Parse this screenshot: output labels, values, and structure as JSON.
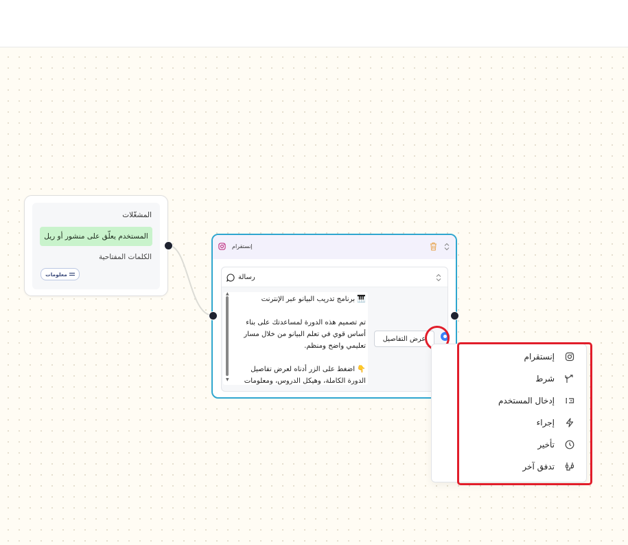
{
  "trigger_node": {
    "title": "المشغّلات",
    "trigger_text": "المستخدم يعلّق على منشور أو ريل",
    "keywords_title": "الكلمات المفتاحية",
    "info_chip_label": "معلومات"
  },
  "instagram_node": {
    "title": "إنستقرام",
    "message": {
      "title": "رسالة",
      "text": "🎹 برنامج تدريب البيانو عبر الإنترنت\n\nتم تصميم هذه الدورة لمساعدتك على بناء أساس قوي في تعلم البيانو من خلال مسار تعليمي واضح ومنظم.\n\n👇 اضغط على الزر أدناه لعرض تفاصيل الدورة الكاملة، وهيكل الدروس، ومعلومات",
      "button_label": "عرض التفاصيل"
    }
  },
  "menu": {
    "items": [
      {
        "label": "إنستقرام",
        "icon": "instagram-icon"
      },
      {
        "label": "شرط",
        "icon": "branch-icon"
      },
      {
        "label": "إدخال المستخدم",
        "icon": "user-input-icon"
      },
      {
        "label": "إجراء",
        "icon": "lightning-icon"
      },
      {
        "label": "تأخير",
        "icon": "clock-icon"
      },
      {
        "label": "تدفق آخر",
        "icon": "flow-icon"
      }
    ]
  },
  "colors": {
    "accent_border": "#2ea6cf",
    "highlight_red": "#e11d2a",
    "trigger_pill": "#c9f3cc",
    "handle_blue": "#3b82f6"
  }
}
